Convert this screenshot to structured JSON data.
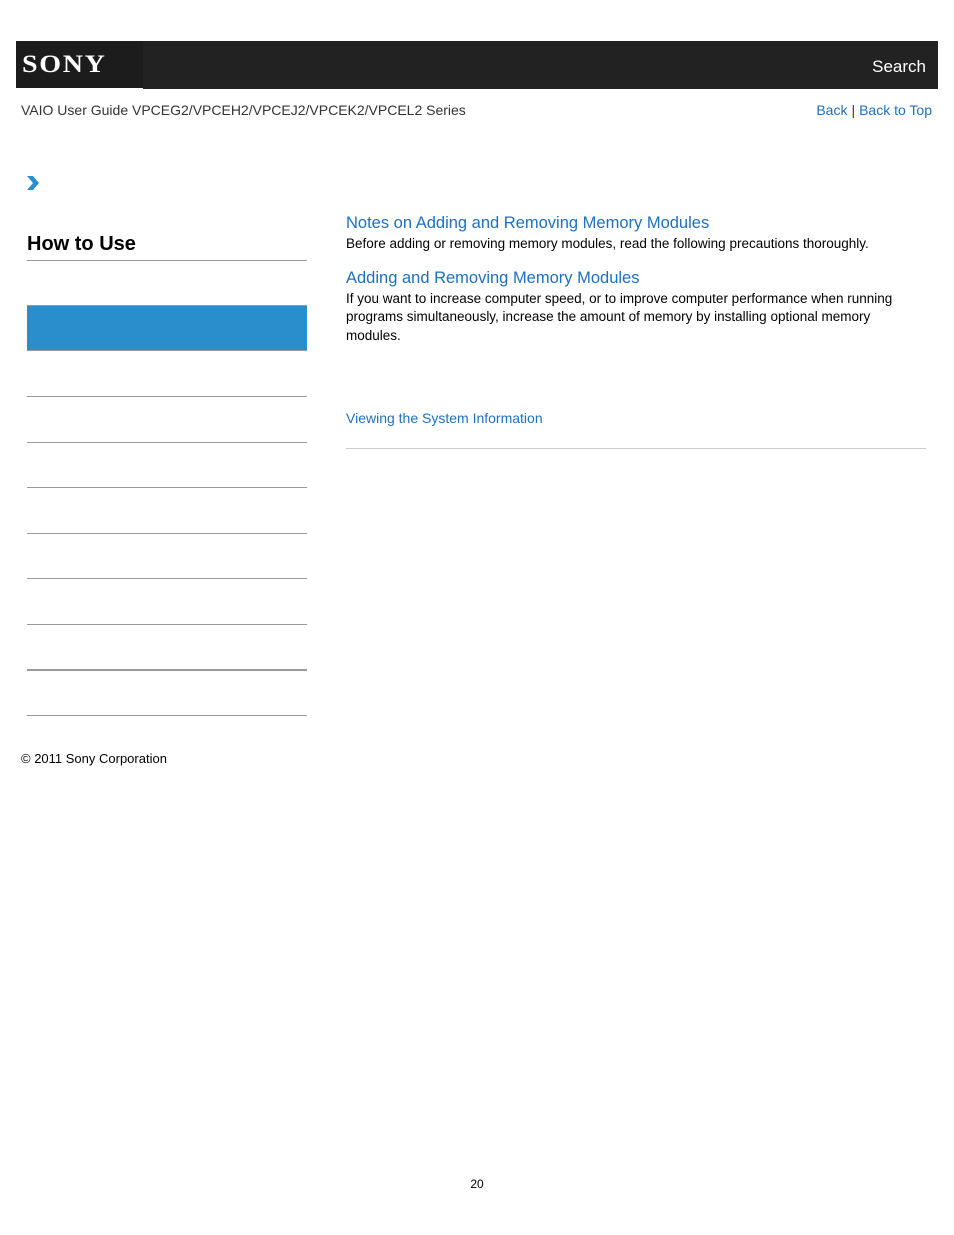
{
  "header": {
    "logo_text": "SONY",
    "search_label": "Search"
  },
  "subheader": {
    "guide_title": "VAIO User Guide VPCEG2/VPCEH2/VPCEJ2/VPCEK2/VPCEL2 Series",
    "back_label": "Back",
    "separator": "|",
    "back_to_top_label": "Back to Top"
  },
  "breadcrumb": {
    "icon": "chevron-right-icon",
    "accent_color": "#2a8ecd"
  },
  "sidebar": {
    "title": "How to Use",
    "active_color": "#2a8ecd",
    "items": [
      {
        "label": "",
        "active": true
      },
      {
        "label": ""
      },
      {
        "label": ""
      },
      {
        "label": ""
      },
      {
        "label": ""
      },
      {
        "label": ""
      },
      {
        "label": ""
      },
      {
        "label": ""
      },
      {
        "label": ""
      }
    ]
  },
  "main": {
    "entries": [
      {
        "title": "Notes on Adding and Removing Memory Modules",
        "description": "Before adding or removing memory modules, read the following precautions thoroughly."
      },
      {
        "title": "Adding and Removing Memory Modules",
        "description": "If you want to increase computer speed, or to improve computer performance when running programs simultaneously, increase the amount of memory by installing optional memory modules."
      }
    ],
    "related_link": "Viewing the System Information",
    "link_color": "#1d70c0"
  },
  "footer": {
    "copyright": "© 2011 Sony Corporation",
    "page_number": "20"
  }
}
